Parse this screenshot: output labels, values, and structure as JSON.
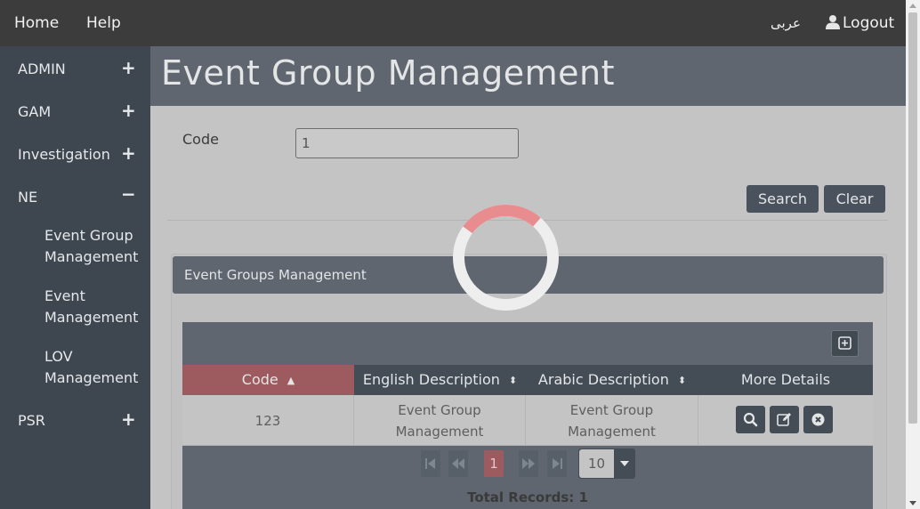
{
  "topbar": {
    "home": "Home",
    "help": "Help",
    "language": "عربى",
    "logout": "Logout"
  },
  "sidebar": {
    "items": [
      {
        "label": "ADMIN",
        "sign": "+"
      },
      {
        "label": "GAM",
        "sign": "+"
      },
      {
        "label": "Investigation",
        "sign": "+"
      },
      {
        "label": "NE",
        "sign": "−"
      },
      {
        "label": "PSR",
        "sign": "+"
      }
    ],
    "ne_subitems": [
      "Event Group Management",
      "Event Management",
      "LOV Management"
    ]
  },
  "page": {
    "title": "Event Group Management"
  },
  "search_form": {
    "code_label": "Code",
    "code_value": "1",
    "search_button": "Search",
    "clear_button": "Clear"
  },
  "panel": {
    "title": "Event Groups Management",
    "columns": [
      "Code",
      "English Description",
      "Arabic Description",
      "More Details"
    ],
    "rows": [
      {
        "code": "123",
        "english": "Event Group Management",
        "arabic": "Event Group Management"
      }
    ],
    "pagination": {
      "current_page": "1",
      "rows_per_page": "10",
      "total_records": "Total Records: 1"
    }
  },
  "colors": {
    "sidebar": "#3e4650",
    "header": "#5f666f",
    "active_accent": "#9e5b5f",
    "spinner_accent": "#e88c8f"
  },
  "icons": [
    "user-icon",
    "column-toggle-icon",
    "sort-up-icon",
    "sort-both-icon",
    "search-icon",
    "edit-icon",
    "delete-icon",
    "first-page-icon",
    "prev-page-icon",
    "next-page-icon",
    "last-page-icon",
    "loading-spinner"
  ]
}
